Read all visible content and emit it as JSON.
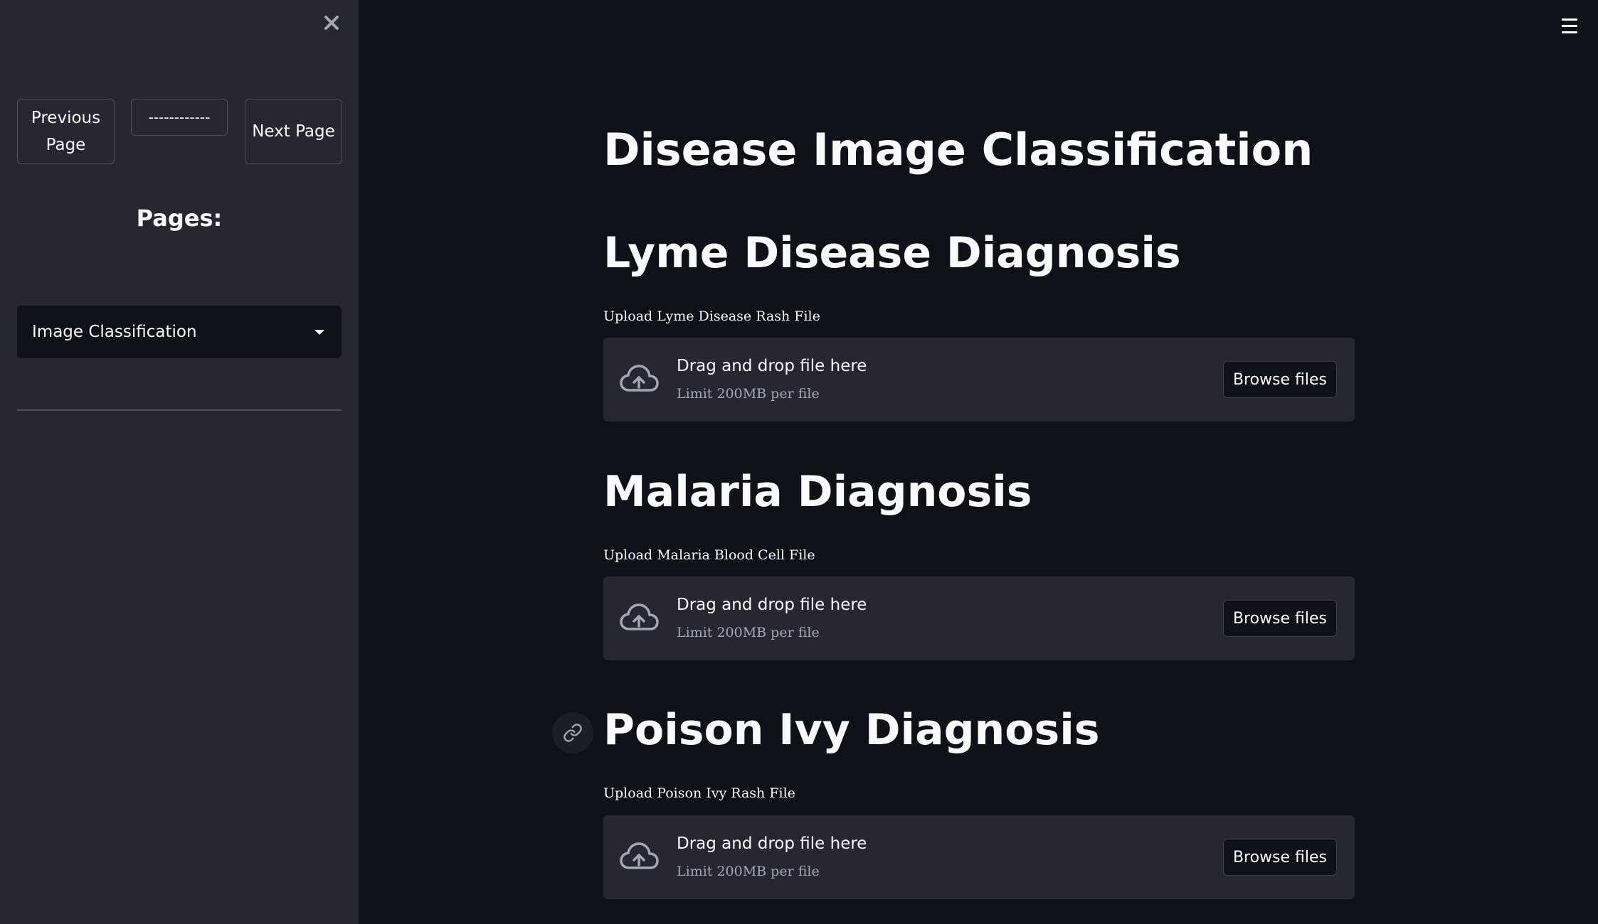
{
  "sidebar": {
    "close_icon": "close-icon",
    "nav": {
      "previous_label": "Previous Page",
      "middle_label": "------------",
      "next_label": "Next Page"
    },
    "pages_title": "Pages:",
    "select": {
      "value": "Image Classification"
    }
  },
  "main": {
    "title": "Disease Image Classification",
    "sections": [
      {
        "heading": "Lyme Disease Diagnosis",
        "upload_label": "Upload Lyme Disease Rash File",
        "drag_text": "Drag and drop file here",
        "limit_text": "Limit 200MB per file",
        "browse_label": "Browse files"
      },
      {
        "heading": "Malaria Diagnosis",
        "upload_label": "Upload Malaria Blood Cell File",
        "drag_text": "Drag and drop file here",
        "limit_text": "Limit 200MB per file",
        "browse_label": "Browse files"
      },
      {
        "heading": "Poison Ivy Diagnosis",
        "upload_label": "Upload Poison Ivy Rash File",
        "drag_text": "Drag and drop file here",
        "limit_text": "Limit 200MB per file",
        "browse_label": "Browse files"
      }
    ]
  },
  "colors": {
    "background": "#0e1117",
    "sidebar": "#262730",
    "text": "#fafafa",
    "muted_text": "#a3a8b8"
  }
}
